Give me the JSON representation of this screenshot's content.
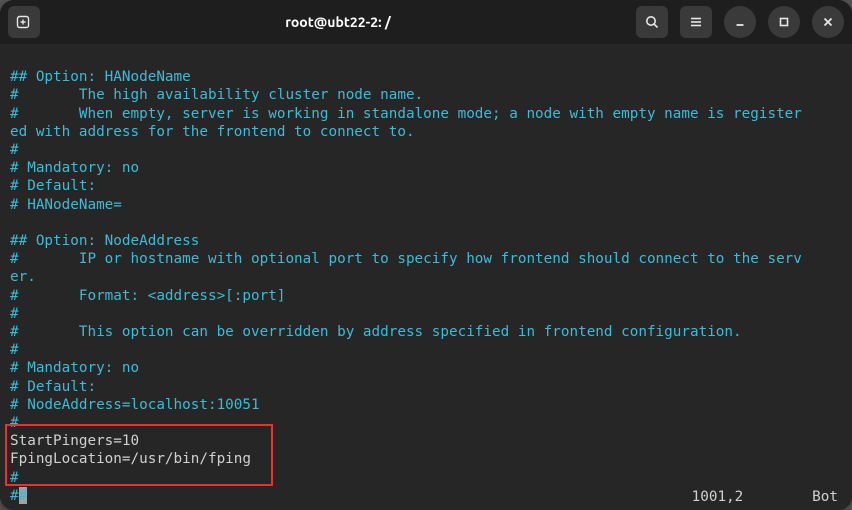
{
  "titlebar": {
    "title": "root@ubt22-2: /"
  },
  "lines": {
    "l1": "## Option: HANodeName",
    "l2": "#       The high availability cluster node name.",
    "l3": "#       When empty, server is working in standalone mode; a node with empty name is register",
    "l4": "ed with address for the frontend to connect to.",
    "l5": "#",
    "l6": "# Mandatory: no",
    "l7": "# Default:",
    "l8": "# HANodeName=",
    "l9": "",
    "l10": "## Option: NodeAddress",
    "l11": "#       IP or hostname with optional port to specify how frontend should connect to the serv",
    "l12": "er.",
    "l13": "#       Format: <address>[:port]",
    "l14": "#",
    "l15": "#       This option can be overridden by address specified in frontend configuration.",
    "l16": "#",
    "l17": "# Mandatory: no",
    "l18": "# Default:",
    "l19": "# NodeAddress=localhost:10051",
    "l20": "#",
    "l21": "StartPingers=10",
    "l22": "FpingLocation=/usr/bin/fping",
    "l23_a": "#",
    "l24_a": "#",
    "l24_b": "#"
  },
  "status": {
    "position": "1001,2",
    "scroll": "Bot"
  },
  "highlight": {
    "top": "380",
    "left": "5",
    "width": "268",
    "height": "62"
  }
}
